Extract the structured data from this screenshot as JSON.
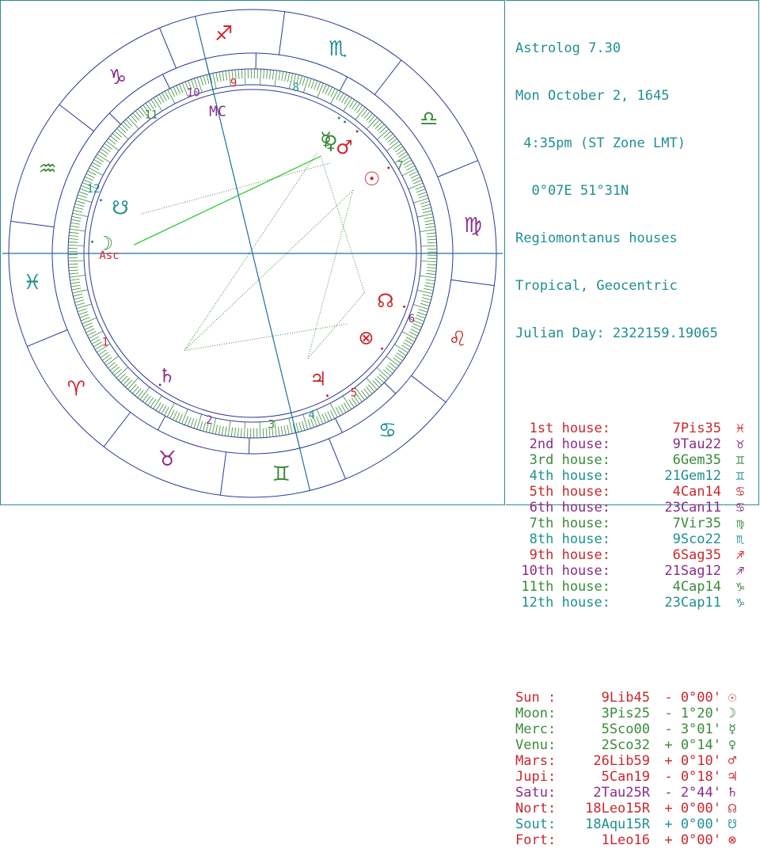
{
  "header": {
    "title": "Astrolog 7.30",
    "date": "Mon October 2, 1645",
    "time": " 4:35pm (ST Zone LMT)",
    "location": "  0°07E 51°31N",
    "house_system": "Regiomontanus houses",
    "zodiac": "Tropical, Geocentric",
    "julian_day": "Julian Day: 2322159.19065"
  },
  "houses": [
    {
      "label": "1st house:",
      "value": " 7Pis35",
      "glyph": "♓",
      "color": "#c8282d"
    },
    {
      "label": "2nd house:",
      "value": " 9Tau22",
      "glyph": "♉",
      "color": "#8a2c8a"
    },
    {
      "label": "3rd house:",
      "value": " 6Gem35",
      "glyph": "♊",
      "color": "#3a8a3a"
    },
    {
      "label": "4th house:",
      "value": "21Gem12",
      "glyph": "♊",
      "color": "#1f8f8f"
    },
    {
      "label": "5th house:",
      "value": " 4Can14",
      "glyph": "♋",
      "color": "#c8282d"
    },
    {
      "label": "6th house:",
      "value": "23Can11",
      "glyph": "♋",
      "color": "#8a2c8a"
    },
    {
      "label": "7th house:",
      "value": " 7Vir35",
      "glyph": "♍",
      "color": "#3a8a3a"
    },
    {
      "label": "8th house:",
      "value": " 9Sco22",
      "glyph": "♏",
      "color": "#1f8f8f"
    },
    {
      "label": "9th house:",
      "value": " 6Sag35",
      "glyph": "♐",
      "color": "#c8282d"
    },
    {
      "label": "10th house:",
      "value": "21Sag12",
      "glyph": "♐",
      "color": "#8a2c8a"
    },
    {
      "label": "11th house:",
      "value": " 4Cap14",
      "glyph": "♑",
      "color": "#3a8a3a"
    },
    {
      "label": "12th house:",
      "value": "23Cap11",
      "glyph": "♑",
      "color": "#1f8f8f"
    }
  ],
  "planets": [
    {
      "name": "Sun :",
      "pos": " 9Lib45",
      "lat": "- 0°00'",
      "glyph": "☉",
      "color": "#c8282d"
    },
    {
      "name": "Moon:",
      "pos": " 3Pis25",
      "lat": "- 1°20'",
      "glyph": "☽",
      "color": "#3a8a3a"
    },
    {
      "name": "Merc:",
      "pos": " 5Sco00",
      "lat": "- 3°01'",
      "glyph": "☿",
      "color": "#3a8a3a"
    },
    {
      "name": "Venu:",
      "pos": " 2Sco32",
      "lat": "+ 0°14'",
      "glyph": "♀",
      "color": "#3a8a3a"
    },
    {
      "name": "Mars:",
      "pos": "26Lib59",
      "lat": "+ 0°10'",
      "glyph": "♂",
      "color": "#c8282d"
    },
    {
      "name": "Jupi:",
      "pos": " 5Can19",
      "lat": "- 0°18'",
      "glyph": "♃",
      "color": "#c8282d"
    },
    {
      "name": "Satu:",
      "pos": " 2Tau25R",
      "lat": "- 2°44'",
      "glyph": "♄",
      "color": "#8a2c8a"
    },
    {
      "name": "Nort:",
      "pos": "18Leo15R",
      "lat": "+ 0°00'",
      "glyph": "☊",
      "color": "#c8282d"
    },
    {
      "name": "Sout:",
      "pos": "18Aqu15R",
      "lat": "+ 0°00'",
      "glyph": "☋",
      "color": "#1f8f8f"
    },
    {
      "name": "Fort:",
      "pos": " 1Leo16",
      "lat": "+ 0°00'",
      "glyph": "⊗",
      "color": "#c8282d"
    }
  ],
  "wheel": {
    "signs": [
      {
        "glyph": "♓",
        "color": "#1f8f8f"
      },
      {
        "glyph": "♈",
        "color": "#c8282d"
      },
      {
        "glyph": "♉",
        "color": "#8a2c8a"
      },
      {
        "glyph": "♊",
        "color": "#3a8a3a"
      },
      {
        "glyph": "♋",
        "color": "#1f8f8f"
      },
      {
        "glyph": "♌",
        "color": "#c8282d"
      },
      {
        "glyph": "♍",
        "color": "#8a2c8a"
      },
      {
        "glyph": "♎",
        "color": "#3a8a3a"
      },
      {
        "glyph": "♏",
        "color": "#1f8f8f"
      },
      {
        "glyph": "♐",
        "color": "#c8282d"
      },
      {
        "glyph": "♑",
        "color": "#8a2c8a"
      },
      {
        "glyph": "♒",
        "color": "#3a8a3a"
      }
    ],
    "house_numbers": [
      {
        "n": "1",
        "color": "#c8282d"
      },
      {
        "n": "2",
        "color": "#8a2c8a"
      },
      {
        "n": "3",
        "color": "#3a8a3a"
      },
      {
        "n": "4",
        "color": "#1f8f8f"
      },
      {
        "n": "5",
        "color": "#c8282d"
      },
      {
        "n": "6",
        "color": "#8a2c8a"
      },
      {
        "n": "7",
        "color": "#3a8a3a"
      },
      {
        "n": "8",
        "color": "#1f8f8f"
      },
      {
        "n": "9",
        "color": "#c8282d"
      },
      {
        "n": "10",
        "color": "#8a2c8a"
      },
      {
        "n": "11",
        "color": "#3a8a3a"
      },
      {
        "n": "12",
        "color": "#1f8f8f"
      }
    ],
    "asc_label": "Asc",
    "mc_label": "MC",
    "line_color": "#2a3a9a",
    "aspect_color": "#3a8a3a",
    "bright_aspect_color": "#33cc33"
  }
}
